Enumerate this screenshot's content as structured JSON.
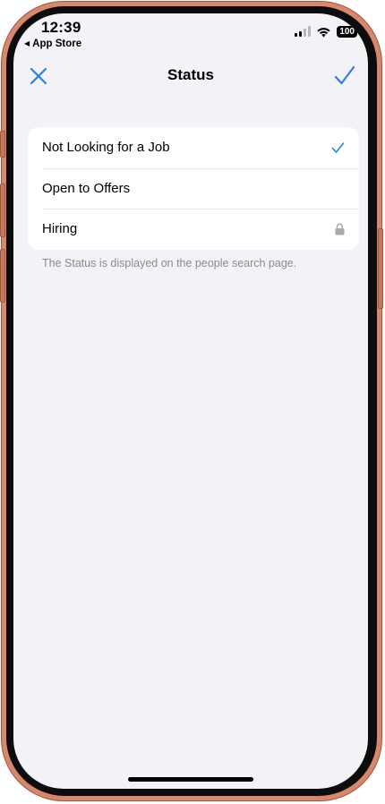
{
  "status_bar": {
    "time": "12:39",
    "back_app": "App Store",
    "battery": "100",
    "icons": [
      "cellular-signal-icon",
      "wifi-icon",
      "battery-icon"
    ]
  },
  "nav": {
    "title": "Status",
    "close_icon": "close-x-icon",
    "done_icon": "checkmark-icon"
  },
  "options": [
    {
      "label": "Not Looking for a Job",
      "selected": true,
      "icon": "checkmark-icon"
    },
    {
      "label": "Open to Offers",
      "selected": false,
      "icon": ""
    },
    {
      "label": "Hiring",
      "selected": false,
      "locked": true,
      "icon": "lock-icon"
    }
  ],
  "footnote": "The Status is displayed on the people search page.",
  "colors": {
    "accent": "#2f7fe0",
    "background": "#f2f2f7",
    "card": "#ffffff",
    "secondary_text": "#8a8a8f",
    "lock": "#a9a9ae",
    "frame": "#d9876c"
  }
}
